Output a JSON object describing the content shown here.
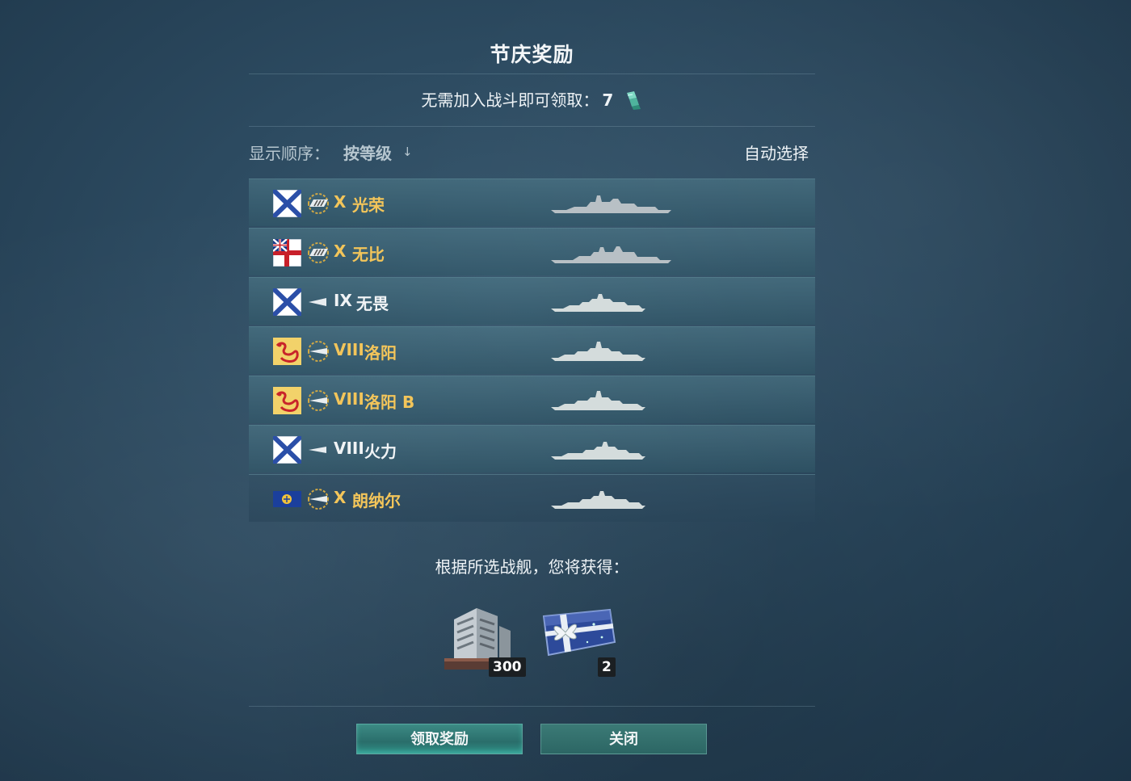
{
  "dialog": {
    "title": "节庆奖励",
    "subtitle_text": "无需加入战斗即可领取：",
    "subtitle_count": "7",
    "token_icon": "container-token-icon",
    "sort_label": "显示顺序：",
    "sort_value": "按等级",
    "sort_arrow": "↓",
    "auto_select": "自动选择",
    "ships": [
      {
        "flag": "russia-naval-flag",
        "class_icon": "battleship-premium-icon",
        "tier": "X",
        "name": "光荣",
        "color": "gold"
      },
      {
        "flag": "uk-white-ensign-flag",
        "class_icon": "battleship-premium-icon",
        "tier": "X",
        "name": "无比",
        "color": "gold"
      },
      {
        "flag": "russia-naval-flag",
        "class_icon": "cruiser-icon",
        "tier": "IX",
        "name": "无畏",
        "color": "white"
      },
      {
        "flag": "pan-asia-dragon-flag",
        "class_icon": "destroyer-premium-icon",
        "tier": "VIII",
        "name": "洛阳",
        "color": "gold"
      },
      {
        "flag": "pan-asia-dragon-flag",
        "class_icon": "destroyer-premium-icon",
        "tier": "VIII",
        "name": "洛阳 B",
        "color": "gold"
      },
      {
        "flag": "russia-naval-flag",
        "class_icon": "destroyer-icon",
        "tier": "VIII",
        "name": "火力",
        "color": "white"
      },
      {
        "flag": "commonwealth-flag",
        "class_icon": "destroyer-premium-icon",
        "tier": "X",
        "name": "朗纳尔",
        "color": "gold"
      }
    ],
    "reward_caption": "根据所选战舰，您将获得：",
    "rewards": [
      {
        "icon": "steel-resource-icon",
        "count": "300"
      },
      {
        "icon": "gift-container-icon",
        "count": "2"
      }
    ],
    "claim_button": "领取奖励",
    "close_button": "关闭"
  }
}
